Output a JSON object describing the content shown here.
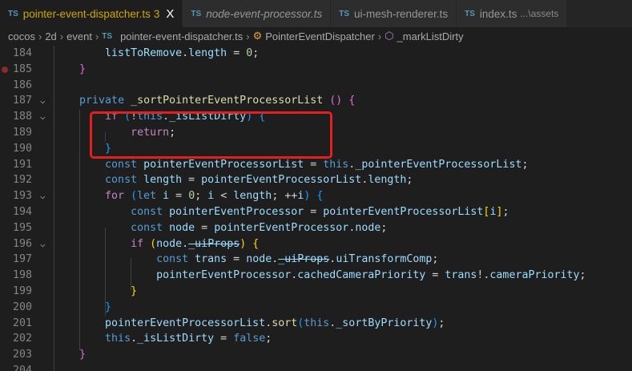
{
  "tabs": [
    {
      "lang": "TS",
      "label": "pointer-event-dispatcher.ts",
      "badge": "3",
      "close": "X",
      "active": true
    },
    {
      "lang": "TS",
      "label": "node-event-processor.ts",
      "italic": true
    },
    {
      "lang": "TS",
      "label": "ui-mesh-renderer.ts"
    },
    {
      "lang": "TS",
      "label": "index.ts",
      "desc": "...\\assets"
    }
  ],
  "breadcrumb": {
    "items": [
      "cocos",
      "2d",
      "event"
    ],
    "file_lang": "TS",
    "file": "pointer-event-dispatcher.ts",
    "class": "PointerEventDispatcher",
    "method": "_markListDirty"
  },
  "colors": {
    "highlight_box": "#e51e1e",
    "active_tab_text": "#cca700"
  },
  "lines": [
    {
      "n": "184",
      "t": [
        [
          "        ",
          ""
        ],
        [
          "listToRemove",
          "var"
        ],
        [
          ".",
          "op"
        ],
        [
          "length",
          "var"
        ],
        [
          " = ",
          "op"
        ],
        [
          "0",
          "num"
        ],
        [
          ";",
          "op"
        ]
      ]
    },
    {
      "n": "185",
      "bp": true,
      "t": [
        [
          "    ",
          ""
        ],
        [
          "}",
          "b2"
        ]
      ]
    },
    {
      "n": "186",
      "t": []
    },
    {
      "n": "187",
      "fold": true,
      "t": [
        [
          "    ",
          ""
        ],
        [
          "private",
          "kw"
        ],
        [
          " ",
          ""
        ],
        [
          "_sortPointerEventProcessorList",
          "fn"
        ],
        [
          " ",
          ""
        ],
        [
          "()",
          "b2"
        ],
        [
          " ",
          ""
        ],
        [
          "{",
          "b2"
        ]
      ]
    },
    {
      "n": "188",
      "fold": true,
      "t": [
        [
          "        ",
          ""
        ],
        [
          "if",
          "ctl"
        ],
        [
          " ",
          ""
        ],
        [
          "(",
          "b3"
        ],
        [
          "!",
          "op"
        ],
        [
          "this",
          "kw"
        ],
        [
          ".",
          "op"
        ],
        [
          "_isListDirty",
          "var"
        ],
        [
          ")",
          "b3"
        ],
        [
          " ",
          ""
        ],
        [
          "{",
          "b3"
        ]
      ]
    },
    {
      "n": "189",
      "t": [
        [
          "            ",
          ""
        ],
        [
          "return",
          "ctl"
        ],
        [
          ";",
          "op"
        ]
      ]
    },
    {
      "n": "190",
      "t": [
        [
          "        ",
          ""
        ],
        [
          "}",
          "b3"
        ]
      ]
    },
    {
      "n": "191",
      "t": [
        [
          "        ",
          ""
        ],
        [
          "const",
          "kw"
        ],
        [
          " ",
          ""
        ],
        [
          "pointerEventProcessorList",
          "var"
        ],
        [
          " = ",
          "op"
        ],
        [
          "this",
          "kw"
        ],
        [
          ".",
          "op"
        ],
        [
          "_pointerEventProcessorList",
          "var"
        ],
        [
          ";",
          "op"
        ]
      ]
    },
    {
      "n": "192",
      "t": [
        [
          "        ",
          ""
        ],
        [
          "const",
          "kw"
        ],
        [
          " ",
          ""
        ],
        [
          "length",
          "var"
        ],
        [
          " = ",
          "op"
        ],
        [
          "pointerEventProcessorList",
          "var"
        ],
        [
          ".",
          "op"
        ],
        [
          "length",
          "var"
        ],
        [
          ";",
          "op"
        ]
      ]
    },
    {
      "n": "193",
      "fold": true,
      "t": [
        [
          "        ",
          ""
        ],
        [
          "for",
          "ctl"
        ],
        [
          " ",
          ""
        ],
        [
          "(",
          "b3"
        ],
        [
          "let",
          "kw"
        ],
        [
          " ",
          ""
        ],
        [
          "i",
          "var"
        ],
        [
          " = ",
          "op"
        ],
        [
          "0",
          "num"
        ],
        [
          "; ",
          "op"
        ],
        [
          "i",
          "var"
        ],
        [
          " < ",
          "op"
        ],
        [
          "length",
          "var"
        ],
        [
          "; ++",
          "op"
        ],
        [
          "i",
          "var"
        ],
        [
          ")",
          "b3"
        ],
        [
          " ",
          ""
        ],
        [
          "{",
          "b3"
        ]
      ]
    },
    {
      "n": "194",
      "t": [
        [
          "            ",
          ""
        ],
        [
          "const",
          "kw"
        ],
        [
          " ",
          ""
        ],
        [
          "pointerEventProcessor",
          "var"
        ],
        [
          " = ",
          "op"
        ],
        [
          "pointerEventProcessorList",
          "var"
        ],
        [
          "[",
          "b1"
        ],
        [
          "i",
          "var"
        ],
        [
          "]",
          "b1"
        ],
        [
          ";",
          "op"
        ]
      ]
    },
    {
      "n": "195",
      "t": [
        [
          "            ",
          ""
        ],
        [
          "const",
          "kw"
        ],
        [
          " ",
          ""
        ],
        [
          "node",
          "var"
        ],
        [
          " = ",
          "op"
        ],
        [
          "pointerEventProcessor",
          "var"
        ],
        [
          ".",
          "op"
        ],
        [
          "node",
          "var"
        ],
        [
          ";",
          "op"
        ]
      ]
    },
    {
      "n": "196",
      "fold": true,
      "t": [
        [
          "            ",
          ""
        ],
        [
          "if",
          "ctl"
        ],
        [
          " ",
          ""
        ],
        [
          "(",
          "b1"
        ],
        [
          "node",
          "var"
        ],
        [
          ".",
          "op"
        ],
        [
          "_uiProps",
          "strike"
        ],
        [
          ")",
          "b1"
        ],
        [
          " ",
          ""
        ],
        [
          "{",
          "b1"
        ]
      ]
    },
    {
      "n": "197",
      "t": [
        [
          "                ",
          ""
        ],
        [
          "const",
          "kw"
        ],
        [
          " ",
          ""
        ],
        [
          "trans",
          "var"
        ],
        [
          " = ",
          "op"
        ],
        [
          "node",
          "var"
        ],
        [
          ".",
          "op"
        ],
        [
          "_uiProps",
          "strike"
        ],
        [
          ".",
          "op"
        ],
        [
          "uiTransformComp",
          "var"
        ],
        [
          ";",
          "op"
        ]
      ]
    },
    {
      "n": "198",
      "t": [
        [
          "                ",
          ""
        ],
        [
          "pointerEventProcessor",
          "var"
        ],
        [
          ".",
          "op"
        ],
        [
          "cachedCameraPriority",
          "var"
        ],
        [
          " = ",
          "op"
        ],
        [
          "trans",
          "var"
        ],
        [
          "!.",
          "op"
        ],
        [
          "cameraPriority",
          "var"
        ],
        [
          ";",
          "op"
        ]
      ]
    },
    {
      "n": "199",
      "t": [
        [
          "            ",
          ""
        ],
        [
          "}",
          "b1"
        ]
      ]
    },
    {
      "n": "200",
      "t": [
        [
          "        ",
          ""
        ],
        [
          "}",
          "b3"
        ]
      ]
    },
    {
      "n": "201",
      "t": [
        [
          "        ",
          ""
        ],
        [
          "pointerEventProcessorList",
          "var"
        ],
        [
          ".",
          "op"
        ],
        [
          "sort",
          "fn"
        ],
        [
          "(",
          "b3"
        ],
        [
          "this",
          "kw"
        ],
        [
          ".",
          "op"
        ],
        [
          "_sortByPriority",
          "var"
        ],
        [
          ")",
          "b3"
        ],
        [
          ";",
          "op"
        ]
      ]
    },
    {
      "n": "202",
      "t": [
        [
          "        ",
          ""
        ],
        [
          "this",
          "kw"
        ],
        [
          ".",
          "op"
        ],
        [
          "_isListDirty",
          "var"
        ],
        [
          " = ",
          "op"
        ],
        [
          "false",
          "kw"
        ],
        [
          ";",
          "op"
        ]
      ]
    },
    {
      "n": "203",
      "t": [
        [
          "    ",
          ""
        ],
        [
          "}",
          "b2"
        ]
      ]
    },
    {
      "n": "204",
      "t": []
    }
  ]
}
